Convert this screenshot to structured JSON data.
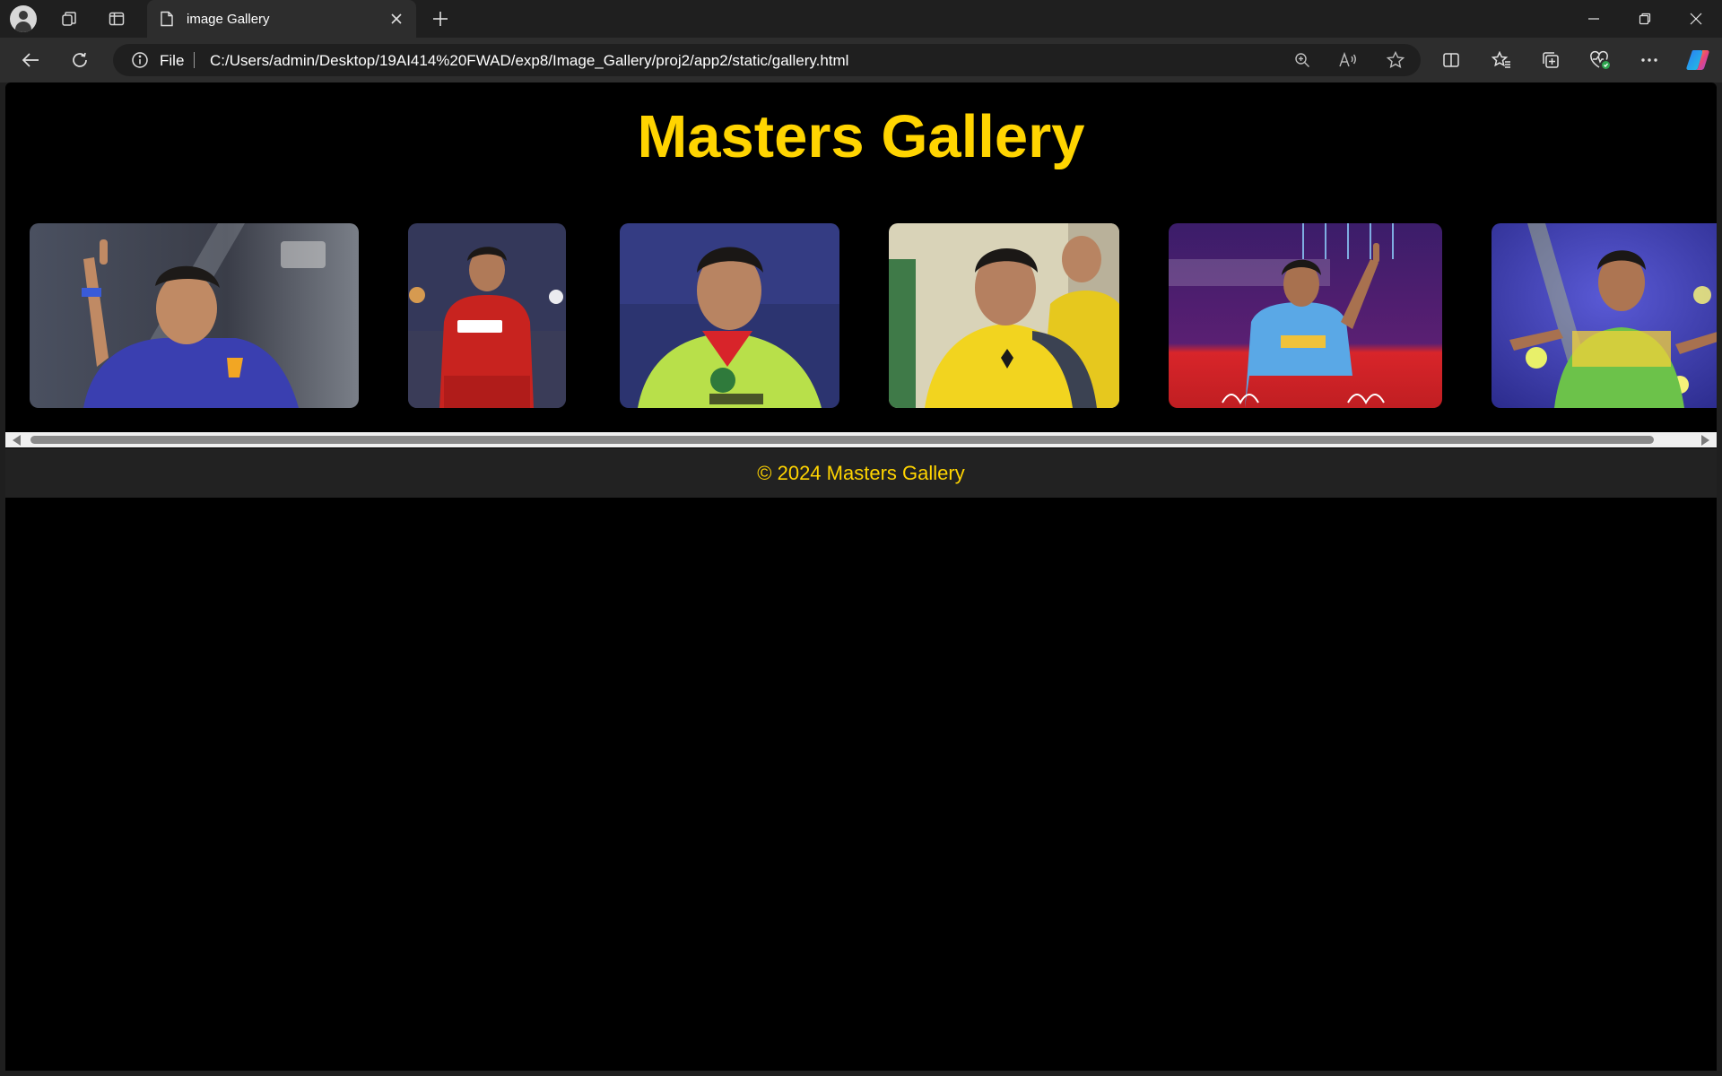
{
  "browser": {
    "tab_title": "image Gallery",
    "address_scheme_label": "File",
    "url": "C:/Users/admin/Desktop/19AI414%20FWAD/exp8/Image_Gallery/proj2/app2/static/gallery.html"
  },
  "page": {
    "title": "Masters Gallery",
    "footer": "© 2024 Masters Gallery"
  },
  "gallery": {
    "items": [
      {
        "jersey_color": "#3a3fb0"
      },
      {
        "jersey_color": "#c8231f"
      },
      {
        "jersey_color": "#b8e04a"
      },
      {
        "jersey_color": "#f2d41f"
      },
      {
        "jersey_color": "#5aa8e6"
      },
      {
        "jersey_color": "#6cc24a"
      }
    ]
  },
  "colors": {
    "accent": "#ffd400",
    "page_bg": "#000000",
    "footer_bg": "#222222"
  }
}
